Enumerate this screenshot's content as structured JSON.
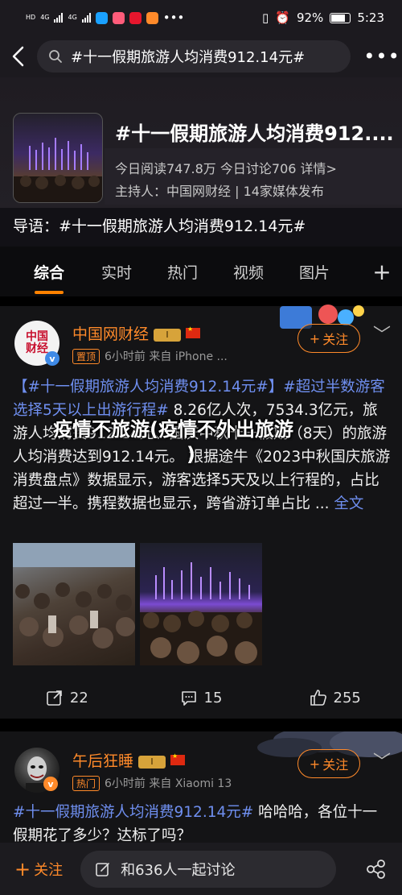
{
  "status_bar": {
    "network_left": "HD",
    "signal_1_label": "4G",
    "signal_2_label": "4G",
    "overflow": "•••",
    "battery": "92%",
    "time": "5:23"
  },
  "search": {
    "query": "#十一假期旅游人均消费912.14元#",
    "back_icon": "back-arrow-icon",
    "more_icon": "more-icon"
  },
  "topic": {
    "title": "#十一假期旅游人均消费912....",
    "stats": "今日阅读747.8万  今日讨论706  详情>",
    "host": "主持人：中国网财经 | 14家媒体发布",
    "intro": "导语：#十一假期旅游人均消费912.14元#"
  },
  "tabs": [
    {
      "label": "综合",
      "active": true
    },
    {
      "label": "实时",
      "active": false
    },
    {
      "label": "热门",
      "active": false
    },
    {
      "label": "视频",
      "active": false
    },
    {
      "label": "图片",
      "active": false
    }
  ],
  "tab_add": "+",
  "post1": {
    "avatar_text_1": "中国",
    "avatar_text_2": "财经",
    "author": "中国网财经",
    "level": "Ⅰ",
    "tag": "置顶",
    "meta": "6小时前  来自 iPhone ...",
    "follow_label": "关注",
    "hashtag_1": "【#十一假期旅游人均消费912.14元#】",
    "hashtag_2": "#超过半数游客选择5天以上出游行程#",
    "text_1": " 8.26亿人次，7534.3亿元，",
    "text_2": "旅游人均消费912.14元、国庆中秋十一假期（8天）的旅游人均消费达到912.14元。 根据途牛《2023中秋国庆旅游消费盘点》数据显示，游客选择5天及以上行程的，占比超过一半。携程数据也显示，跨省游订单占比 ... ",
    "full_text_link": "全文",
    "overlay_line_1": "疫情不旅游(疫情不外出旅游",
    "overlay_line_2": ")",
    "repost_count": "22",
    "comment_count": "15",
    "like_count": "255"
  },
  "post2": {
    "author": "午后狂睡",
    "level": "Ⅰ",
    "tag": "热门",
    "meta": "6小时前  来自 Xiaomi 13",
    "follow_label": "关注",
    "hashtag": "#十一假期旅游人均消费912.14元#",
    "text": " 哈哈哈，各位十一假期花了多少？达标了吗？"
  },
  "bottom": {
    "follow_label": "关注",
    "discuss_label": "和636人一起讨论"
  },
  "colors": {
    "accent": "#ff8a2a",
    "link": "#6f8ff0",
    "tab_indicator": "#ff8200"
  }
}
